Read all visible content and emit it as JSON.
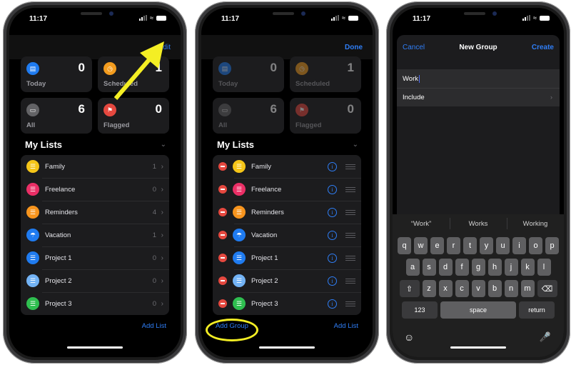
{
  "status": {
    "time": "11:17"
  },
  "screen1": {
    "nav_action": "Edit",
    "tiles": [
      {
        "label": "Today",
        "count": "0",
        "icon": "calendar-icon",
        "color": "#1f7bf0"
      },
      {
        "label": "Scheduled",
        "count": "1",
        "icon": "clock-icon",
        "color": "#f39c1e"
      },
      {
        "label": "All",
        "count": "6",
        "icon": "tray-icon",
        "color": "#636366"
      },
      {
        "label": "Flagged",
        "count": "0",
        "icon": "flag-icon",
        "color": "#e5483f"
      }
    ],
    "section_title": "My Lists",
    "lists": [
      {
        "name": "Family",
        "count": "1",
        "color": "#f5c518",
        "icon": "list-icon"
      },
      {
        "name": "Freelance",
        "count": "0",
        "color": "#ea2f66",
        "icon": "list-icon"
      },
      {
        "name": "Reminders",
        "count": "4",
        "color": "#f7941d",
        "icon": "list-icon"
      },
      {
        "name": "Vacation",
        "count": "1",
        "color": "#1f7bf0",
        "icon": "umbrella-icon"
      },
      {
        "name": "Project 1",
        "count": "0",
        "color": "#1f7bf0",
        "icon": "list-icon"
      },
      {
        "name": "Project 2",
        "count": "0",
        "color": "#73b3f5",
        "icon": "list-icon"
      },
      {
        "name": "Project 3",
        "count": "0",
        "color": "#2fbf50",
        "icon": "list-icon"
      }
    ],
    "add_list": "Add List"
  },
  "screen2": {
    "nav_action": "Done",
    "add_group": "Add Group",
    "add_list": "Add List"
  },
  "screen3": {
    "cancel": "Cancel",
    "title": "New Group",
    "create": "Create",
    "name_value": "Work",
    "include_label": "Include",
    "suggestions": [
      "“Work”",
      "Works",
      "Working"
    ],
    "keyboard": {
      "row1": [
        "q",
        "w",
        "e",
        "r",
        "t",
        "y",
        "u",
        "i",
        "o",
        "p"
      ],
      "row2": [
        "a",
        "s",
        "d",
        "f",
        "g",
        "h",
        "j",
        "k",
        "l"
      ],
      "row3": [
        "z",
        "x",
        "c",
        "v",
        "b",
        "n",
        "m"
      ],
      "numbers": "123",
      "space": "space",
      "return": "return"
    }
  },
  "annotation_color": "#f4ee24"
}
